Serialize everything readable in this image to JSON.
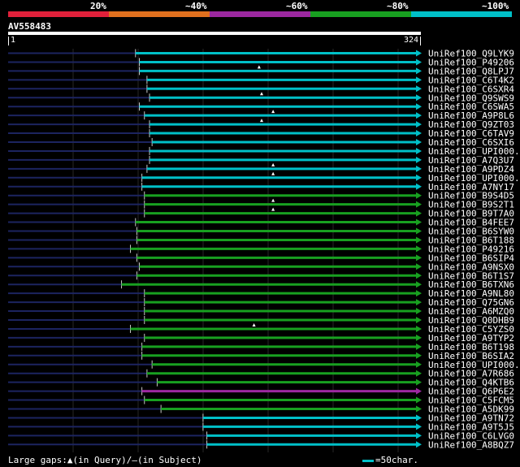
{
  "legend": {
    "labels": [
      "20%",
      "~40%",
      "~60%",
      "~80%",
      "~100%"
    ],
    "colors": [
      "#e0203a",
      "#e0701e",
      "#9c28a0",
      "#18a020",
      "#00c0c8"
    ]
  },
  "query": {
    "id": "AV558483",
    "start": "1",
    "end": "324",
    "length": 324
  },
  "hits": [
    {
      "name": "UniRef100_Q9LYK9",
      "start": 100,
      "color": "cyan",
      "gap": null
    },
    {
      "name": "UniRef100_P49206",
      "start": 103,
      "color": "cyan",
      "gap": null
    },
    {
      "name": "UniRef100_Q8LPJ7",
      "start": 103,
      "color": "cyan",
      "gap": 197
    },
    {
      "name": "UniRef100_C6T4K2",
      "start": 109,
      "color": "cyan",
      "gap": null
    },
    {
      "name": "UniRef100_C6SXR4",
      "start": 109,
      "color": "cyan",
      "gap": null
    },
    {
      "name": "UniRef100_Q9SWS9",
      "start": 111,
      "color": "cyan",
      "gap": 199
    },
    {
      "name": "UniRef100_C6SWA5",
      "start": 103,
      "color": "cyan",
      "gap": null
    },
    {
      "name": "UniRef100_A9P8L6",
      "start": 107,
      "color": "cyan",
      "gap": 208
    },
    {
      "name": "UniRef100_Q9ZT03",
      "start": 111,
      "color": "cyan",
      "gap": 199
    },
    {
      "name": "UniRef100_C6TAV9",
      "start": 111,
      "color": "cyan",
      "gap": null
    },
    {
      "name": "UniRef100_C6SXI6",
      "start": 113,
      "color": "cyan",
      "gap": null
    },
    {
      "name": "UniRef100_UPI000..",
      "start": 111,
      "color": "cyan",
      "gap": null
    },
    {
      "name": "UniRef100_A7Q3U7",
      "start": 111,
      "color": "cyan",
      "gap": null
    },
    {
      "name": "UniRef100_A9PDZ4",
      "start": 109,
      "color": "cyan",
      "gap": 208
    },
    {
      "name": "UniRef100_UPI000..",
      "start": 105,
      "color": "cyan",
      "gap": 208
    },
    {
      "name": "UniRef100_A7NY17",
      "start": 105,
      "color": "cyan",
      "gap": null
    },
    {
      "name": "UniRef100_B9S4D5",
      "start": 107,
      "color": "green",
      "gap": null
    },
    {
      "name": "UniRef100_B9S2T1",
      "start": 107,
      "color": "green",
      "gap": 208
    },
    {
      "name": "UniRef100_B9T7A0",
      "start": 107,
      "color": "green",
      "gap": 208
    },
    {
      "name": "UniRef100_B4FEE7",
      "start": 100,
      "color": "green",
      "gap": null
    },
    {
      "name": "UniRef100_B6SYW0",
      "start": 101,
      "color": "green",
      "gap": null
    },
    {
      "name": "UniRef100_B6T188",
      "start": 101,
      "color": "green",
      "gap": null
    },
    {
      "name": "UniRef100_P49216",
      "start": 96,
      "color": "green",
      "gap": null
    },
    {
      "name": "UniRef100_B6SIP4",
      "start": 101,
      "color": "green",
      "gap": null
    },
    {
      "name": "UniRef100_A9NSX0",
      "start": 103,
      "color": "green",
      "gap": null
    },
    {
      "name": "UniRef100_B6T1S7",
      "start": 101,
      "color": "green",
      "gap": null
    },
    {
      "name": "UniRef100_B6TXN6",
      "start": 89,
      "color": "green",
      "gap": null
    },
    {
      "name": "UniRef100_A9NL80",
      "start": 107,
      "color": "green",
      "gap": null
    },
    {
      "name": "UniRef100_Q75GN6",
      "start": 107,
      "color": "green",
      "gap": null
    },
    {
      "name": "UniRef100_A6MZQ0",
      "start": 107,
      "color": "green",
      "gap": null
    },
    {
      "name": "UniRef100_Q0DHB9",
      "start": 107,
      "color": "green",
      "gap": null
    },
    {
      "name": "UniRef100_C5YZS0",
      "start": 96,
      "color": "green",
      "gap": 193
    },
    {
      "name": "UniRef100_A9TYP2",
      "start": 107,
      "color": "green",
      "gap": null
    },
    {
      "name": "UniRef100_B6T198",
      "start": 105,
      "color": "green",
      "gap": null
    },
    {
      "name": "UniRef100_B6SIA2",
      "start": 105,
      "color": "green",
      "gap": null
    },
    {
      "name": "UniRef100_UPI000..",
      "start": 113,
      "color": "green",
      "gap": null
    },
    {
      "name": "UniRef100_A7R686",
      "start": 109,
      "color": "green",
      "gap": null
    },
    {
      "name": "UniRef100_Q4KTB6",
      "start": 117,
      "color": "green",
      "gap": null
    },
    {
      "name": "UniRef100_Q6P6E2",
      "start": 105,
      "color": "purple",
      "gap": null
    },
    {
      "name": "UniRef100_C5FCM5",
      "start": 107,
      "color": "green",
      "gap": null
    },
    {
      "name": "UniRef100_A5DK99",
      "start": 120,
      "color": "green",
      "gap": null
    },
    {
      "name": "UniRef100_A9TN72",
      "start": 153,
      "color": "cyan",
      "gap": null
    },
    {
      "name": "UniRef100_A9T5J5",
      "start": 153,
      "color": "cyan",
      "gap": null
    },
    {
      "name": "UniRef100_C6LVG0",
      "start": 156,
      "color": "cyan",
      "gap": null
    },
    {
      "name": "UniRef100_A8BQZ7",
      "start": 156,
      "color": "cyan",
      "gap": null
    }
  ],
  "footer": {
    "large_gaps": "Large gaps:",
    "in_query": "(in Query)/",
    "dash": "–",
    "in_subject": "(in Subject)",
    "scale": "=50char."
  }
}
